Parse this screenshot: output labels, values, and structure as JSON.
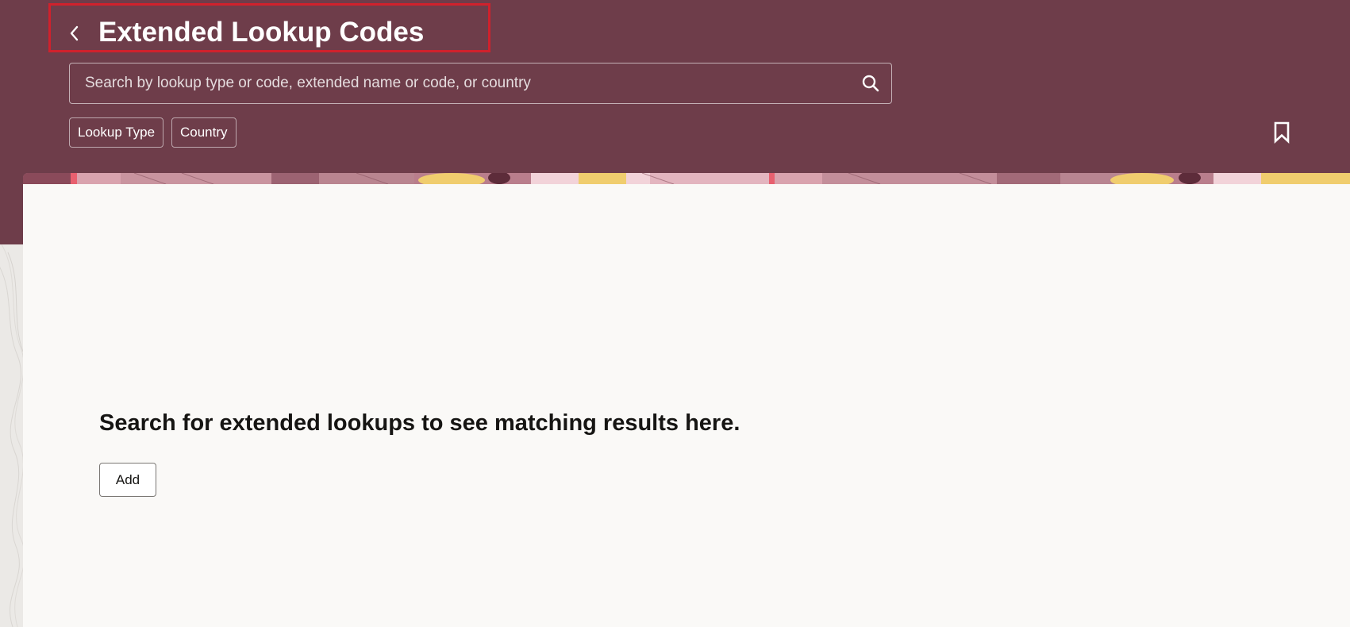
{
  "header": {
    "title": "Extended Lookup Codes",
    "back_icon": "chevron-left-icon",
    "bookmark_icon": "bookmark-icon"
  },
  "search": {
    "placeholder": "Search by lookup type or code, extended name or code, or country",
    "value": "",
    "icon": "search-icon"
  },
  "filters": {
    "lookup_type": "Lookup Type",
    "country": "Country"
  },
  "empty_state": {
    "message": "Search for extended lookups to see matching results here.",
    "add_label": "Add"
  },
  "colors": {
    "header_bg": "#6e3d4a",
    "highlight_border": "#d0212c",
    "card_bg": "#faf9f7",
    "banner_pink": "#c98c9a",
    "banner_yellow": "#f0cd6e",
    "banner_light": "#f2d3d9"
  }
}
